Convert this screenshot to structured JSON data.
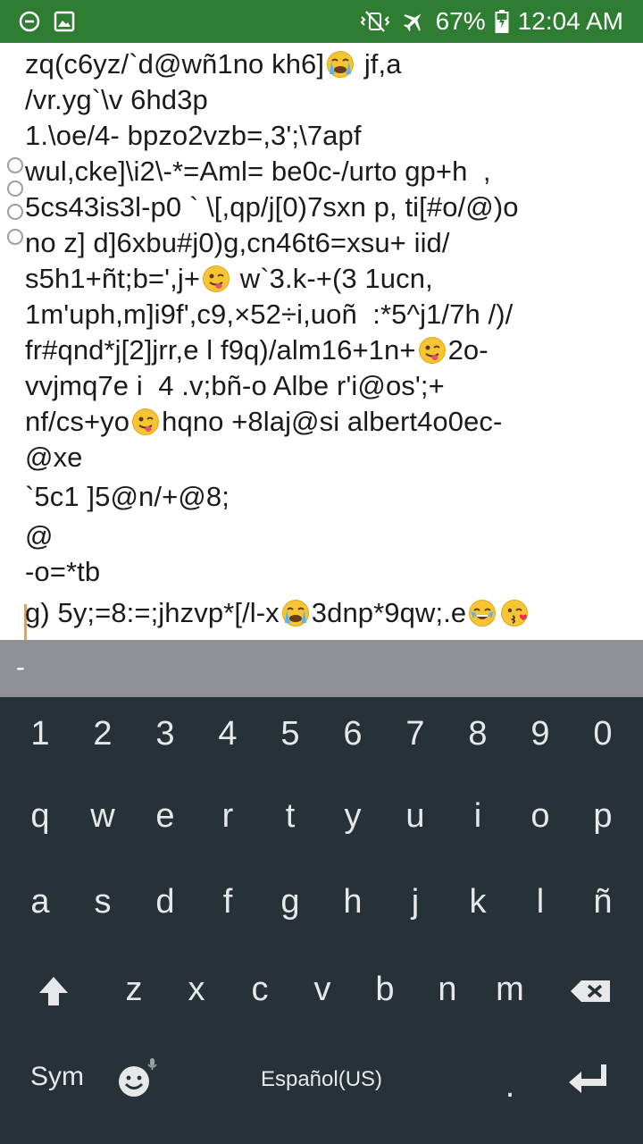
{
  "status_bar": {
    "battery_percent": "67%",
    "time": "12:04 AM",
    "left_icons": [
      "minus-circle-icon",
      "image-icon"
    ],
    "right_icons": [
      "vibrate-mute-icon",
      "airplane-icon",
      "battery-icon"
    ]
  },
  "editor": {
    "lines": [
      {
        "text": "zq(c6yz/`d@wñ1no kh6]",
        "emoji_after": "crying-emoji",
        "tail": " jf,a"
      },
      {
        "text": "/vr.yg`\\v 6hd3p"
      },
      {
        "text": "1.\\oe/4- bpzo2vzb=,3';\\7apf"
      },
      {
        "text": "wul,cke]\\i2\\-*=Aml= be0c-/urto gp+h  ,"
      },
      {
        "text": "5cs43is3l-p0 ` \\[,qp/j[0)7sxn p, ti[#o/@)o"
      },
      {
        "text": "no z] d]6xbu#j0)g,cn46t6=xsu+ iid/"
      },
      {
        "text": "s5h1+ñt;b=',j+",
        "emoji_after": "winking-tongue-emoji",
        "tail": " w`3.k-+(3 1ucn,"
      },
      {
        "text": "1m'uph,m]i9f',c9,×52÷i,uoñ  :*5^j1/7h /)/"
      },
      {
        "text": "fr#qnd*j[2]jrr,e l f9q)/alm16+1n+",
        "emoji_after": "winking-tongue-emoji",
        "tail": "2o-"
      },
      {
        "text": "vvjmq7e i  4 .v;bñ-o Albe r'i@os';+"
      },
      {
        "text": "nf/cs+yo",
        "emoji_after": "winking-tongue-emoji",
        "tail": "hqno +8laj@si albert4o0ec-"
      },
      {
        "text": "@xe"
      },
      {
        "text": "`5c1 ]5@n/+@8;"
      },
      {
        "text": "@"
      },
      {
        "text": "-o=*tb"
      },
      {
        "text": "g) 5y;=8:=;jhzvp*[/l-x",
        "emoji_after": "crying-emoji",
        "tail": "3dnp*9qw;.e",
        "emoji_after2": "joy-emoji",
        "emoji_after3": "kiss-emoji"
      }
    ]
  },
  "suggestion": {
    "text": "-"
  },
  "keyboard": {
    "row_numbers": [
      "1",
      "2",
      "3",
      "4",
      "5",
      "6",
      "7",
      "8",
      "9",
      "0"
    ],
    "row_q": [
      "q",
      "w",
      "e",
      "r",
      "t",
      "y",
      "u",
      "i",
      "o",
      "p"
    ],
    "row_a": [
      "a",
      "s",
      "d",
      "f",
      "g",
      "h",
      "j",
      "k",
      "l",
      "ñ"
    ],
    "row_z": [
      "z",
      "x",
      "c",
      "v",
      "b",
      "n",
      "m"
    ],
    "sym_label": "Sym",
    "language_label": "Español(US)",
    "period_label": ".",
    "shift_icon": "shift-arrow-icon",
    "backspace_icon": "backspace-icon",
    "emoji_icon": "smiley-icon",
    "mic_icon": "microphone-icon",
    "enter_icon": "enter-icon",
    "colors": {
      "background": "#263238",
      "key_text": "#e6e8ea",
      "suggestion_strip": "#8e9096",
      "status_bar": "#2e7d32",
      "caret": "#e8a33a"
    }
  }
}
